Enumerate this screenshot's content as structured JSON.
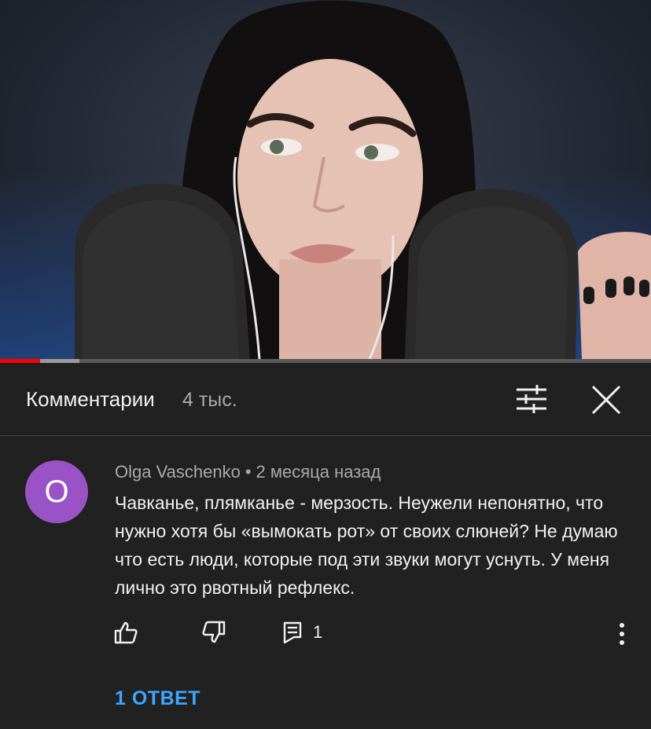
{
  "video": {
    "progress_fraction": 0.062,
    "buffered_fraction": 0.122
  },
  "header": {
    "title": "Комментарии",
    "count": "4 тыс.",
    "filter_icon": "sliders-icon",
    "close_icon": "close-icon"
  },
  "comment": {
    "avatar_letter": "O",
    "avatar_color": "#9a53c6",
    "author": "Olga Vaschenko",
    "separator": "•",
    "time": "2 месяца назад",
    "text": "Чавканье, плямканье - мерзость. Неужели непонятно, что нужно хотя бы «вымокать рот» от своих слюней? Не думаю что есть люди, которые под эти звуки могут уснуть. У меня лично это рвотный рефлекс.",
    "reply_count": "1",
    "replies_label": "1 ОТВЕТ"
  },
  "colors": {
    "background": "#212121",
    "link": "#3ea6ff",
    "progress": "#ff0000"
  }
}
